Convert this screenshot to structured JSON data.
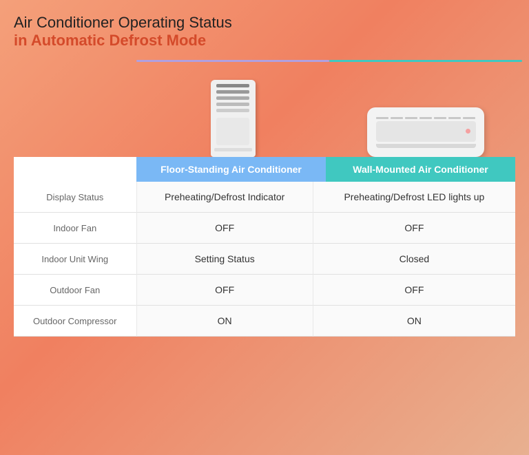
{
  "title": {
    "line1": "Air Conditioner Operating Status",
    "line2": "in Automatic Defrost Mode"
  },
  "columns": {
    "left_header": "Floor-Standing Air Conditioner",
    "right_header": "Wall-Mounted Air Conditioner"
  },
  "rows": [
    {
      "label": "Display Status",
      "left": "Preheating/Defrost Indicator",
      "right": "Preheating/Defrost LED lights up"
    },
    {
      "label": "Indoor Fan",
      "left": "OFF",
      "right": "OFF"
    },
    {
      "label": "Indoor Unit Wing",
      "left": "Setting Status",
      "right": "Closed"
    },
    {
      "label": "Outdoor Fan",
      "left": "OFF",
      "right": "OFF"
    },
    {
      "label": "Outdoor Compressor",
      "left": "ON",
      "right": "ON"
    }
  ],
  "colors": {
    "background_gradient_start": "#f4a07a",
    "background_gradient_end": "#e8b090",
    "title_accent": "#d44a2a",
    "col_header_left": "#7ab8f5",
    "col_header_right": "#40c8c0",
    "underline_left": "#b0a0e0",
    "underline_right": "#40c8c0"
  }
}
